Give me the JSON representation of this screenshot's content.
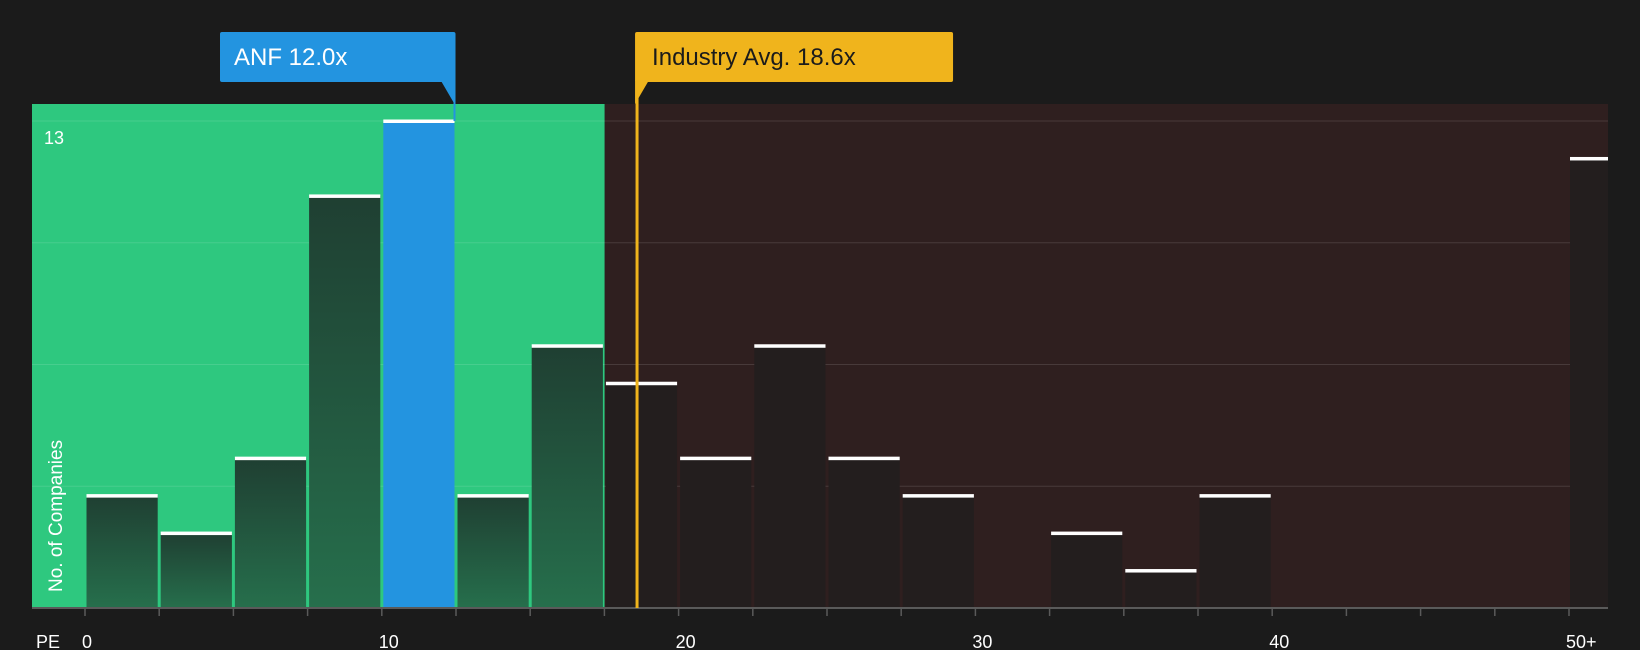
{
  "chart_data": {
    "type": "bar",
    "x_axis_label": "PE",
    "y_axis_label": "No. of Companies",
    "y_max_label": "13",
    "ylim": [
      0,
      13
    ],
    "bin_width": 2.5,
    "bin_starts": [
      0,
      2.5,
      5,
      7.5,
      10,
      12.5,
      15,
      17.5,
      20,
      22.5,
      25,
      27.5,
      30,
      32.5,
      35,
      37.5,
      40,
      42.5,
      45,
      47.5,
      50
    ],
    "values": [
      3,
      2,
      4,
      11,
      13,
      3,
      7,
      6,
      4,
      7,
      4,
      3,
      0,
      2,
      1,
      3,
      0,
      0,
      0,
      0,
      12
    ],
    "highlight_bin_index": 4,
    "x_ticks": [
      {
        "value": 0,
        "label": "0"
      },
      {
        "value": 10,
        "label": "10"
      },
      {
        "value": 20,
        "label": "20"
      },
      {
        "value": 30,
        "label": "30"
      },
      {
        "value": 40,
        "label": "40"
      },
      {
        "value": 50,
        "label": "50+"
      }
    ],
    "company": {
      "ticker": "ANF",
      "value": 12.0,
      "label": "ANF 12.0x"
    },
    "industry_avg": {
      "value": 18.6,
      "label": "Industry Avg. 18.6x"
    },
    "grid": true,
    "colors": {
      "background": "#1b1b1b",
      "undervalued_zone": "#2ec87f",
      "overvalued_zone": "#2f1f1f",
      "company": "#2394e0",
      "industry": "#f0b41c",
      "bar_in_green": "#1f3c30",
      "bar_in_red": "#231e1e",
      "bar_cap": "#ffffff",
      "axis": "#5a5a5a",
      "text": "#ffffff"
    }
  }
}
